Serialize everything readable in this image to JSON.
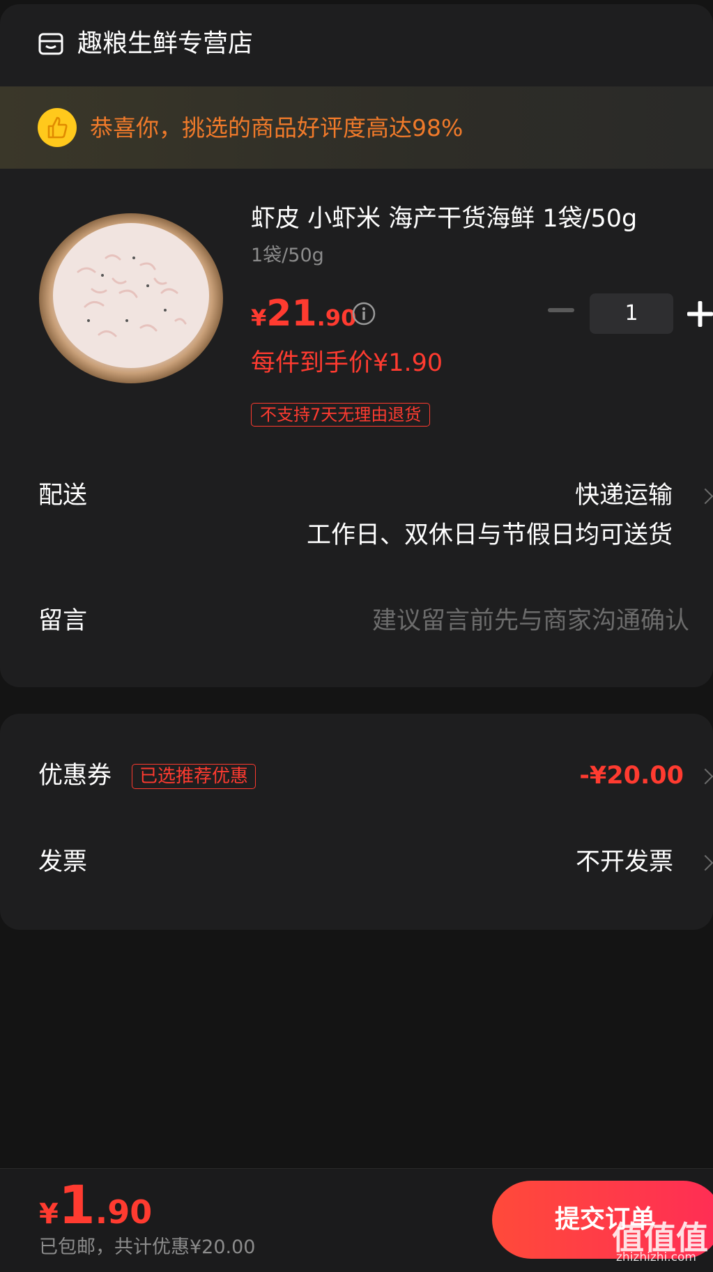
{
  "store": {
    "name": "趣粮生鲜专营店",
    "icon": "store-icon"
  },
  "banner": {
    "text": "恭喜你，挑选的商品好评度高达98%",
    "icon": "thumbs-up-icon"
  },
  "product": {
    "title": "虾皮 小虾米 海产干货海鲜 1袋/50g",
    "spec": "1袋/50g",
    "price_symbol": "¥",
    "price_integer": "21",
    "price_decimal": ".90",
    "quantity": "1",
    "unit_price_text": "每件到手价¥1.90",
    "return_policy": "不支持7天无理由退货"
  },
  "delivery": {
    "label": "配送",
    "method": "快递运输",
    "note": "工作日、双休日与节假日均可送货"
  },
  "message": {
    "label": "留言",
    "placeholder": "建议留言前先与商家沟通确认"
  },
  "coupon": {
    "label": "优惠券",
    "tag": "已选推荐优惠",
    "value": "-¥20.00"
  },
  "invoice": {
    "label": "发票",
    "value": "不开发票"
  },
  "footer": {
    "total_symbol": "¥",
    "total_integer": "1",
    "total_decimal": ".90",
    "summary": "已包邮，共计优惠¥20.00",
    "submit_label": "提交订单",
    "watermark": "值值值",
    "watermark_url": "zhizhizhi.com"
  },
  "colors": {
    "accent_red": "#ff3b30",
    "banner_orange": "#f07a2a",
    "background": "#141414",
    "card": "#1e1e1f"
  }
}
